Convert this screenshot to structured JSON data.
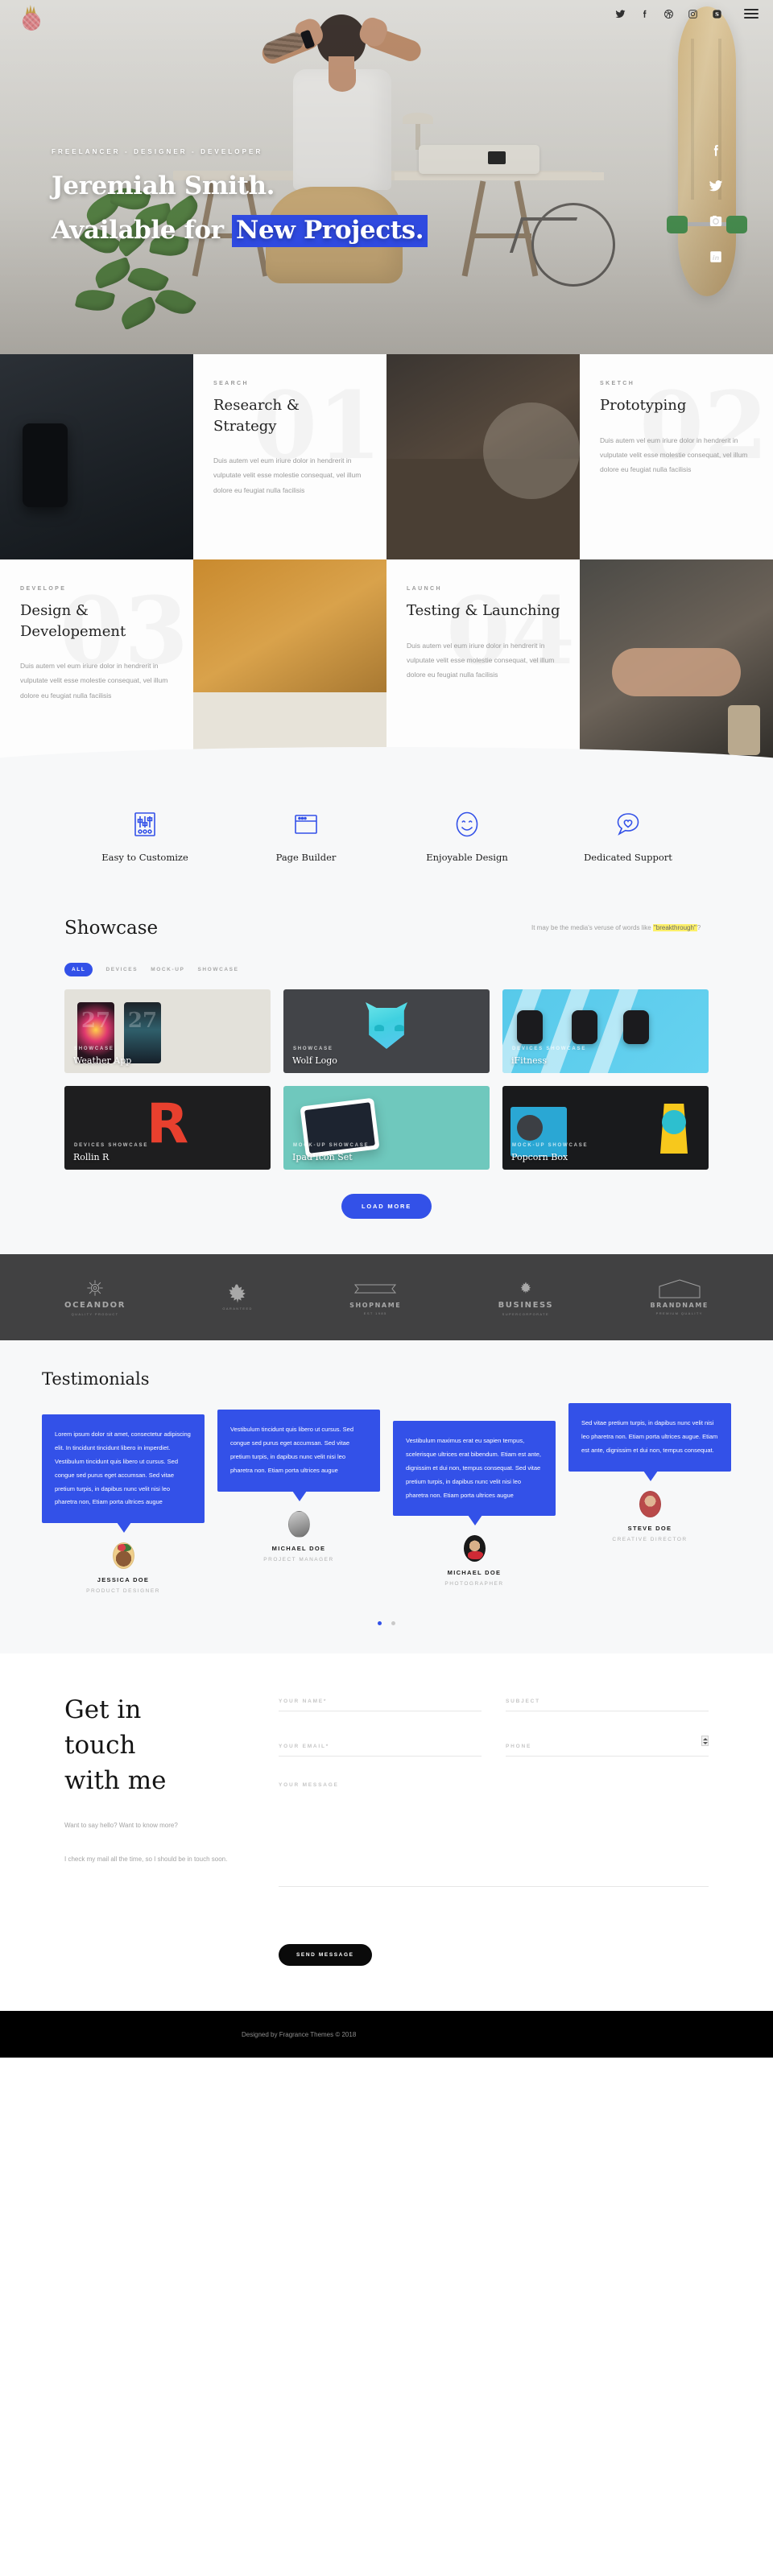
{
  "topbar": {
    "social": [
      {
        "name": "twitter-icon",
        "label": "Twitter"
      },
      {
        "name": "facebook-icon",
        "label": "Facebook"
      },
      {
        "name": "dribbble-icon",
        "label": "Dribbble"
      },
      {
        "name": "instagram-icon",
        "label": "Instagram"
      },
      {
        "name": "skype-icon",
        "label": "Skype"
      }
    ],
    "menu_label": "Menu"
  },
  "side_social": [
    {
      "name": "facebook-icon",
      "label": "Facebook"
    },
    {
      "name": "twitter-icon",
      "label": "Twitter"
    },
    {
      "name": "instagram-icon",
      "label": "Instagram"
    },
    {
      "name": "linkedin-icon",
      "label": "LinkedIn"
    }
  ],
  "hero": {
    "eyebrow": "FREELANCER - DESIGNER - DEVELOPER",
    "name_line": "Jeremiah Smith.",
    "available_prefix": "Available for ",
    "highlight": "New Projects.",
    "highlight_color": "#2f4ae0"
  },
  "services": [
    {
      "kicker": "SEARCH",
      "title": "Research & Strategy",
      "body": "Duis autem vel eum iriure dolor in hendrerit in vulputate velit esse molestie consequat, vel illum dolore eu feugiat nulla facilisis",
      "number": "01"
    },
    {
      "kicker": "SKETCH",
      "title": "Prototyping",
      "body": "Duis autem vel eum iriure dolor in hendrerit in vulputate velit esse molestie consequat, vel illum dolore eu feugiat nulla facilisis",
      "number": "02"
    },
    {
      "kicker": "DEVELOPE",
      "title": "Design & Developement",
      "body": "Duis autem vel eum iriure dolor in hendrerit in vulputate velit esse molestie consequat, vel illum dolore eu feugiat nulla facilisis",
      "number": "03"
    },
    {
      "kicker": "LAUNCH",
      "title": "Testing & Launching",
      "body": "Duis autem vel eum iriure dolor in hendrerit in vulputate velit esse molestie consequat, vel illum dolore eu feugiat nulla facilisis",
      "number": "04"
    }
  ],
  "features": {
    "accent": "#3351e8",
    "items": [
      {
        "icon": "sliders-icon",
        "label": "Easy to Customize"
      },
      {
        "icon": "browser-window-icon",
        "label": "Page Builder"
      },
      {
        "icon": "smiley-face-icon",
        "label": "Enjoyable Design"
      },
      {
        "icon": "heart-speech-bubble-icon",
        "label": "Dedicated Support"
      }
    ]
  },
  "showcase": {
    "title": "Showcase",
    "note_prefix": "It may be the media's veruse of words like ",
    "note_highlight": "\"breakthrough\"",
    "note_suffix": "?",
    "highlight_color": "#fcf06a",
    "filters": [
      {
        "label": "ALL",
        "active": true
      },
      {
        "label": "DEVICES",
        "active": false
      },
      {
        "label": "MOCK-UP",
        "active": false
      },
      {
        "label": "SHOWCASE",
        "active": false
      }
    ],
    "items": [
      {
        "category": "SHOWCASE",
        "name": "Weather App"
      },
      {
        "category": "SHOWCASE",
        "name": "Wolf Logo"
      },
      {
        "category": "DEVICES  SHOWCASE",
        "name": "iFitness"
      },
      {
        "category": "DEVICES  SHOWCASE",
        "name": "Rollin R"
      },
      {
        "category": "MOCK-UP  SHOWCASE",
        "name": "Ipad Icon Set"
      },
      {
        "category": "MOCK-UP  SHOWCASE",
        "name": "Popcorn Box"
      }
    ],
    "load_more": "LOAD MORE"
  },
  "clients": [
    {
      "name": "OCEANDOR",
      "sub": "quality product",
      "mark": "ship-wheel-icon"
    },
    {
      "name": "",
      "sub": "garanteed",
      "mark": "maple-leaf-icon"
    },
    {
      "name": "SHOPNAME",
      "sub": "est 1985",
      "mark": "ribbon-banner-icon"
    },
    {
      "name": "BUSINESS",
      "sub": "supercorporate",
      "mark": "small-leaf-icon"
    },
    {
      "name": "BRANDNAME",
      "sub": "premium quality",
      "mark": "hexagon-badge-icon"
    }
  ],
  "testimonials": {
    "title": "Testimonials",
    "accent": "#3351e8",
    "items": [
      {
        "quote": "Lorem ipsum dolor sit amet, consectetur adipiscing elit. In tincidunt tincidunt libero in imperdiet. Vestibulum tincidunt quis libero ut cursus. Sed congue sed purus eget accumsan. Sed vitae pretium turpis, in dapibus nunc velit nisi leo pharetra non, Etiam porta ultrices augue",
        "name": "JESSICA DOE",
        "role": "PRODUCT DESIGNER"
      },
      {
        "quote": "Vestibulum tincidunt quis libero ut cursus. Sed congue sed purus eget accumsan. Sed vitae pretium turpis, in dapibus nunc velit nisi leo pharetra non. Etiam porta ultrices augue",
        "name": "MICHAEL DOE",
        "role": "PROJECT MANAGER"
      },
      {
        "quote": "Vestibulum maximus erat eu sapien tempus, scelerisque ultrices erat bibendum. Etiam est ante, dignissim et dui non, tempus consequat. Sed vitae pretium turpis, in dapibus nunc velit nisi leo pharetra non. Etiam porta ultrices augue",
        "name": "MICHAEL DOE",
        "role": "PHOTOGRAPHER"
      },
      {
        "quote": "Sed vitae pretium turpis, in dapibus nunc velit nisi leo pharetra non. Etiam porta ultrices augue. Etiam est ante, dignissim et dui non, tempus consequat.",
        "name": "STEVE DOE",
        "role": "CREATIVE DIRECTOR"
      }
    ],
    "dots": 2,
    "active_dot": 0
  },
  "contact": {
    "heading_line1": "Get in",
    "heading_line2": "touch",
    "heading_line3": "with me",
    "blurb1": "Want to say hello? Want to know more?",
    "blurb2": "I check my mail all the time, so I should be in touch soon.",
    "fields": {
      "name_placeholder": "YOUR NAME*",
      "subject_placeholder": "SUBJECT",
      "email_placeholder": "YOUR EMAIL*",
      "phone_placeholder": "PHONE",
      "message_placeholder": "YOUR MESSAGE",
      "name_value": "",
      "subject_value": "",
      "email_value": "",
      "phone_value": "",
      "message_value": ""
    },
    "submit_label": "SEND MESSAGE"
  },
  "footer": {
    "text": "Designed by Fragrance Themes © 2018"
  }
}
